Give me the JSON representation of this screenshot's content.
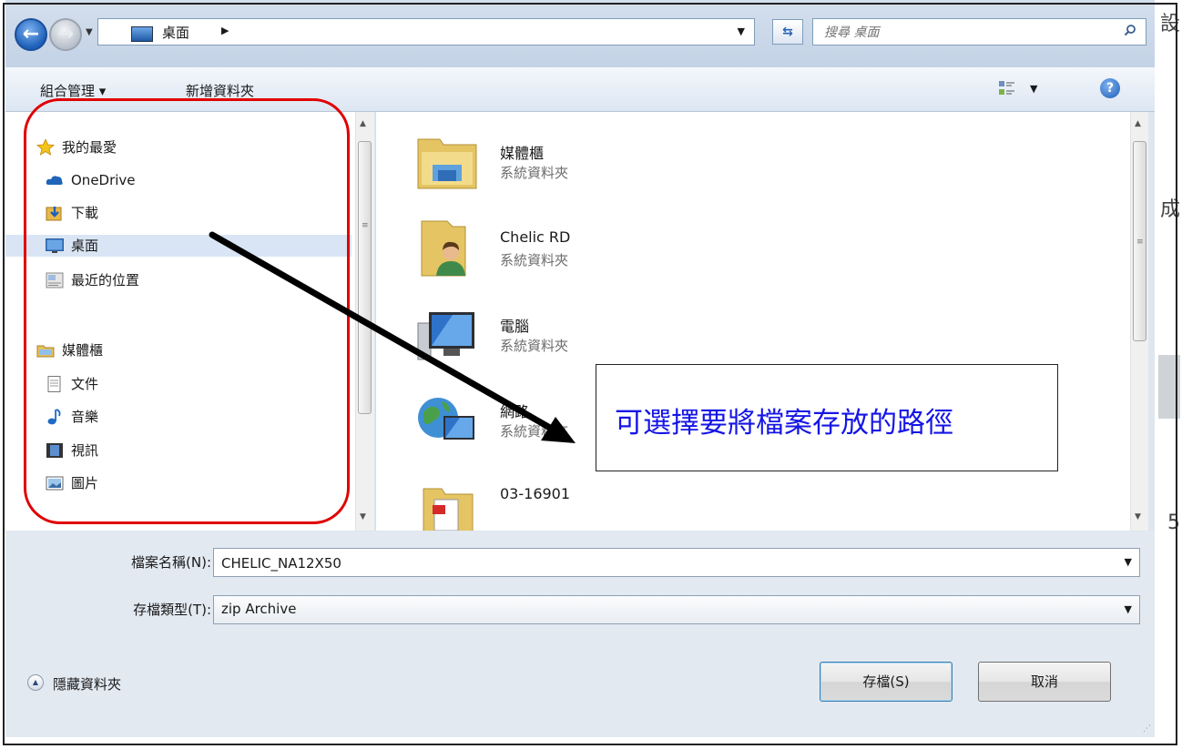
{
  "window": {
    "address": {
      "location_label": "桌面"
    },
    "search": {
      "placeholder": "搜尋 桌面"
    }
  },
  "toolbar": {
    "organize_label": "組合管理 ▾",
    "new_folder_label": "新增資料夾"
  },
  "sidebar": {
    "favorites": {
      "header": "我的最愛",
      "items": [
        {
          "label": "OneDrive",
          "icon": "onedrive-icon"
        },
        {
          "label": "下載",
          "icon": "downloads-icon"
        },
        {
          "label": "桌面",
          "icon": "desktop-icon",
          "selected": true
        },
        {
          "label": "最近的位置",
          "icon": "recent-places-icon"
        }
      ]
    },
    "libraries": {
      "header": "媒體櫃",
      "items": [
        {
          "label": "文件",
          "icon": "documents-icon"
        },
        {
          "label": "音樂",
          "icon": "music-icon"
        },
        {
          "label": "視訊",
          "icon": "videos-icon"
        },
        {
          "label": "圖片",
          "icon": "pictures-icon"
        }
      ]
    }
  },
  "files": [
    {
      "name": "媒體櫃",
      "type": "系統資料夾",
      "icon": "libraries-folder-icon"
    },
    {
      "name": "Chelic RD",
      "type": "系統資料夾",
      "icon": "user-folder-icon"
    },
    {
      "name": "電腦",
      "type": "系統資料夾",
      "icon": "computer-icon"
    },
    {
      "name": "網路",
      "type": "系統資料夾",
      "icon": "network-icon"
    },
    {
      "name": "03-16901",
      "type": "",
      "icon": "pdf-file-icon"
    }
  ],
  "annotation": {
    "callout_text": "可選擇要將檔案存放的路徑",
    "outline_color": "#e00000",
    "text_color": "#1515e6"
  },
  "form": {
    "filename_label": "檔案名稱(N):",
    "filename_value": "CHELIC_NA12X50",
    "filetype_label": "存檔類型(T):",
    "filetype_value": "zip Archive",
    "hide_folders_label": "隱藏資料夾",
    "save_label": "存檔(S)",
    "cancel_label": "取消"
  },
  "background_page": {
    "right_edge_chars": [
      "設",
      "成",
      "5"
    ]
  }
}
